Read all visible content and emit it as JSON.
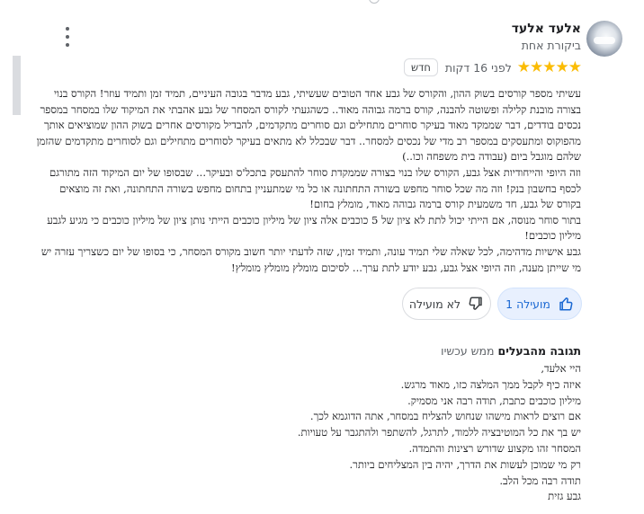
{
  "reviewer": {
    "name": "אלעד אלעד",
    "subtitle": "ביקורת אחת"
  },
  "review": {
    "rating": 5,
    "stars_display": "★★★★★",
    "time": "לפני 16 דקות",
    "badge": "חדש",
    "paragraphs": [
      "עשיתי מספר קורסים בשוק ההון, והקורס של גבע אחד הטובים שעשיתי, גבע מדבר בגובה העיניים, תמיד זמן ותמיד עוזר! הקורס בנוי בצורה מובנת קלילה ופשוטה להבנה, קורס ברמה גבוהה מאוד.. כשהגעתי לקורס המסחר של גבע אהבתי את המיקוד שלו במסחר במספר נכסים בודדים, דבר שממקד מאוד בעיקר סוחרים מתחילים וגם סוחרים מתקדמים, להבדיל מקורסים אחרים בשוק ההון שמוציאים אותך מהפוקוס ומתעסקים במספר רב מדי של נכסים למסחר.. דבר שבכלל לא מתאים בעיקר לסוחרים מתחילים וגם לסוחרים מתקדמים שהזמן שלהם מוגבל ביום (עבודה בית משפחה וכו..)",
      "וזה היופי והייחודיות אצל גבע, הקורס שלו בנוי בצורה שממקדת סוחר להתעסק בתכל'ס  ובעיקר... שבסופו של יום המיקוד הזה מתורגם לכסף בחשבון בנק! וזה מה שכל סוחר מחפש בשורה התחתונה או כל מי שמתעניין בתחום מחפש בשורה התחתונה, ואת זה מוצאים בקורס של גבע, חד משמעית קורס ברמה גבוהה מאוד, מומלץ בחום!",
      "בתור סוחר מנוסה, אם הייתי יכול לתת לא ציון של 5 כוכבים אלה ציון של מיליון כוכבים הייתי נותן ציון של מיליון כוכבים כי מגיע לגבע מיליון כוכבים!",
      "גבע אישיות מדהימה, לכל שאלה שלי תמיד עונה, ותמיד זמין, שזה לדעתי יותר חשוב מקורס המסחר, כי בסופו של יום כשצריך עזרה יש מי שייתן מענה, וזה היופי אצל גבע, גבע יודע לתת ערך... לסיכום מומלץ מומלץ מומלץ!"
    ]
  },
  "actions": {
    "helpful_label": "מועילה 1",
    "not_helpful_label": "לא מועילה"
  },
  "owner_reply": {
    "title": "תגובה מהבעלים",
    "time": "ממש עכשיו",
    "lines": [
      "היי אלעד,",
      "איזה כיף לקבל ממך המלצה כזו, מאוד מרגש.",
      "מיליון כוכבים כתבת, תודה רבה אני מסמיק.",
      "אם רוצים לראות מישהו שנחוש להצליח במסחר, אתה הדוגמא לכך.",
      "יש בך את כל המוטיבציה ללמוד, לתרגל, להשתפר ולהתגבר על טעויות.",
      "המסחר זהו מקצוע שדורש רצינות והתמדה.",
      "רק מי שמוכן לעשות את הדרך, יהיה בין המצליחים ביותר.",
      "תודה רבה מכל הלב.",
      "גבע גזית"
    ]
  },
  "colors": {
    "star": "#fbbc04",
    "accent": "#1967d2",
    "helpful_bg": "#e8f0fe"
  },
  "icons": {
    "menu": "more-vert-icon",
    "thumb_up": "thumb-up-icon",
    "thumb_down": "thumb-down-icon"
  }
}
